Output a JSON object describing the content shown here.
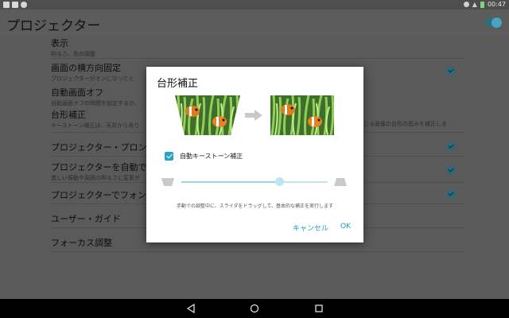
{
  "status_bar": {
    "time": "00:47"
  },
  "app_bar": {
    "title": "プロジェクター"
  },
  "settings": [
    {
      "title": "表示",
      "subtitle": "明るさ、色の調整",
      "checked": false
    },
    {
      "title": "画面の横方向固定",
      "subtitle": "プロジェクターがオンになったと",
      "checked": true
    },
    {
      "title": "自動画面オフ",
      "subtitle": "自動画面オフの時間を設定するか、",
      "checked": false
    },
    {
      "title": "台形補正",
      "subtitle": "キーストーン補正は、天井から吊り",
      "subtitle_tail": "じる画像の台形の歪みを補正しま",
      "checked": false
    },
    {
      "title": "プロジェクター・プロンプ",
      "subtitle": "",
      "checked": true
    },
    {
      "title": "プロジェクターを自動で調",
      "subtitle": "激しい振動や周囲の明るさに変更が",
      "checked": true
    },
    {
      "title": "プロジェクターでフォント",
      "subtitle": "",
      "checked": true
    },
    {
      "title": "ユーザー・ガイド",
      "subtitle": "",
      "checked": false
    },
    {
      "title": "フォーカス調整",
      "subtitle": "",
      "checked": false
    }
  ],
  "dialog": {
    "title": "台形補正",
    "auto_keystone_label": "自動キーストーン補正",
    "auto_keystone_checked": true,
    "slider_value": 0.67,
    "hint": "手動での調整中に、スライダをドラッグして、基本的な補正を実行します",
    "cancel_label": "キャンセル",
    "ok_label": "OK"
  },
  "colors": {
    "accent": "#1b9cbd",
    "scrim": "#5a5a5a"
  }
}
